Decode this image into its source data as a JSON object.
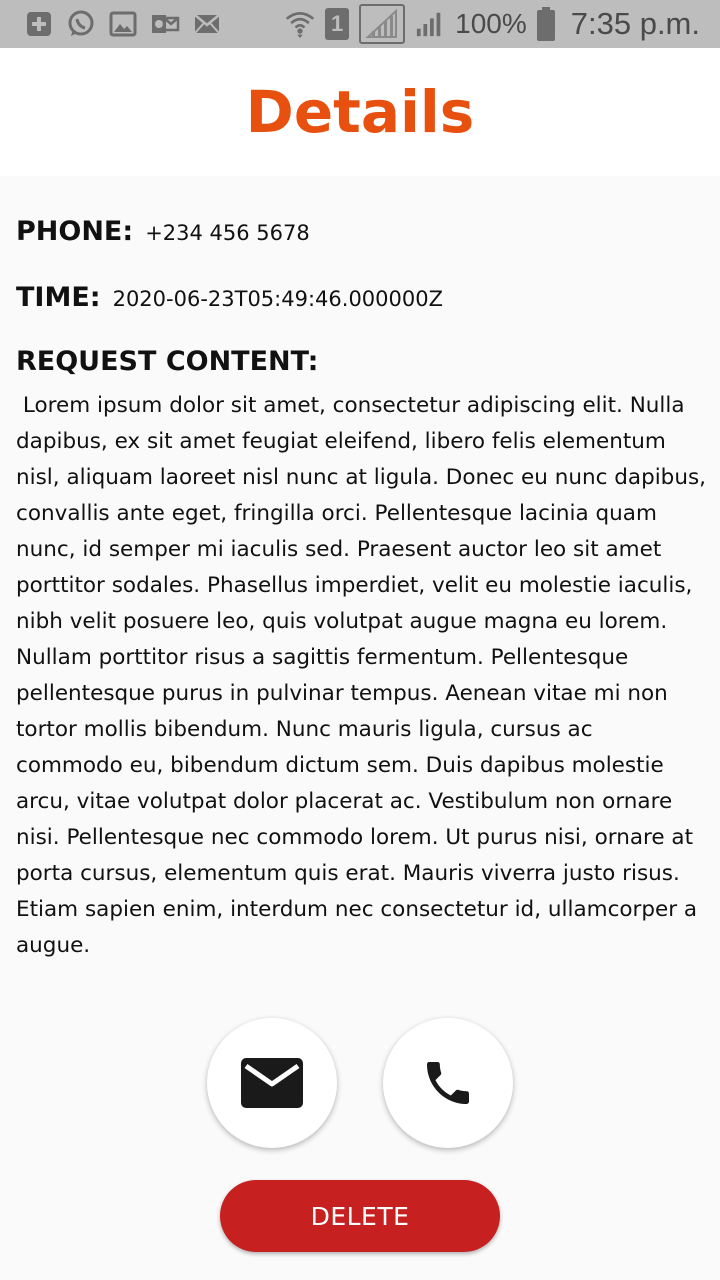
{
  "status_bar": {
    "left_icons": [
      "plus-box-icon",
      "whatsapp-icon",
      "image-icon",
      "outlook-icon",
      "mail-icon"
    ],
    "right_icons": [
      "wifi-icon",
      "sim-1-icon",
      "signal-empty-icon",
      "signal-icon",
      "battery-icon"
    ],
    "sim_label": "1",
    "battery": "100%",
    "time": "7:35 p.m."
  },
  "header": {
    "title": "Details"
  },
  "details": {
    "phone_label": "PHONE:",
    "phone_value": "+234 456 5678",
    "time_label": "TIME:",
    "time_value": "2020-06-23T05:49:46.000000Z",
    "request_label": "REQUEST CONTENT:",
    "request_body": " Lorem ipsum dolor sit amet, consectetur adipiscing elit. Nulla dapibus, ex sit amet feugiat eleifend, libero felis elementum nisl, aliquam laoreet nisl nunc at ligula. Donec eu nunc dapibus, convallis ante eget, fringilla orci. Pellentesque lacinia quam nunc, id semper mi iaculis sed. Praesent auctor leo sit amet porttitor sodales. Phasellus imperdiet, velit eu molestie iaculis, nibh velit posuere leo, quis volutpat augue magna eu lorem. Nullam porttitor risus a sagittis fermentum. Pellentesque pellentesque purus in pulvinar tempus. Aenean vitae mi non tortor mollis bibendum. Nunc mauris ligula, cursus ac commodo eu, bibendum dictum sem. Duis dapibus molestie arcu, vitae volutpat dolor placerat ac. Vestibulum non ornare nisi. Pellentesque nec commodo lorem. Ut purus nisi, ornare at porta cursus, elementum quis erat. Mauris viverra justo risus. Etiam sapien enim, interdum nec consectetur id, ullamcorper a augue."
  },
  "actions": {
    "email_icon": "email-icon",
    "call_icon": "phone-icon",
    "delete_label": "DELETE"
  },
  "colors": {
    "title": "#e8500f",
    "delete_button": "#c62020",
    "status_bar": "#bdbdbd"
  }
}
